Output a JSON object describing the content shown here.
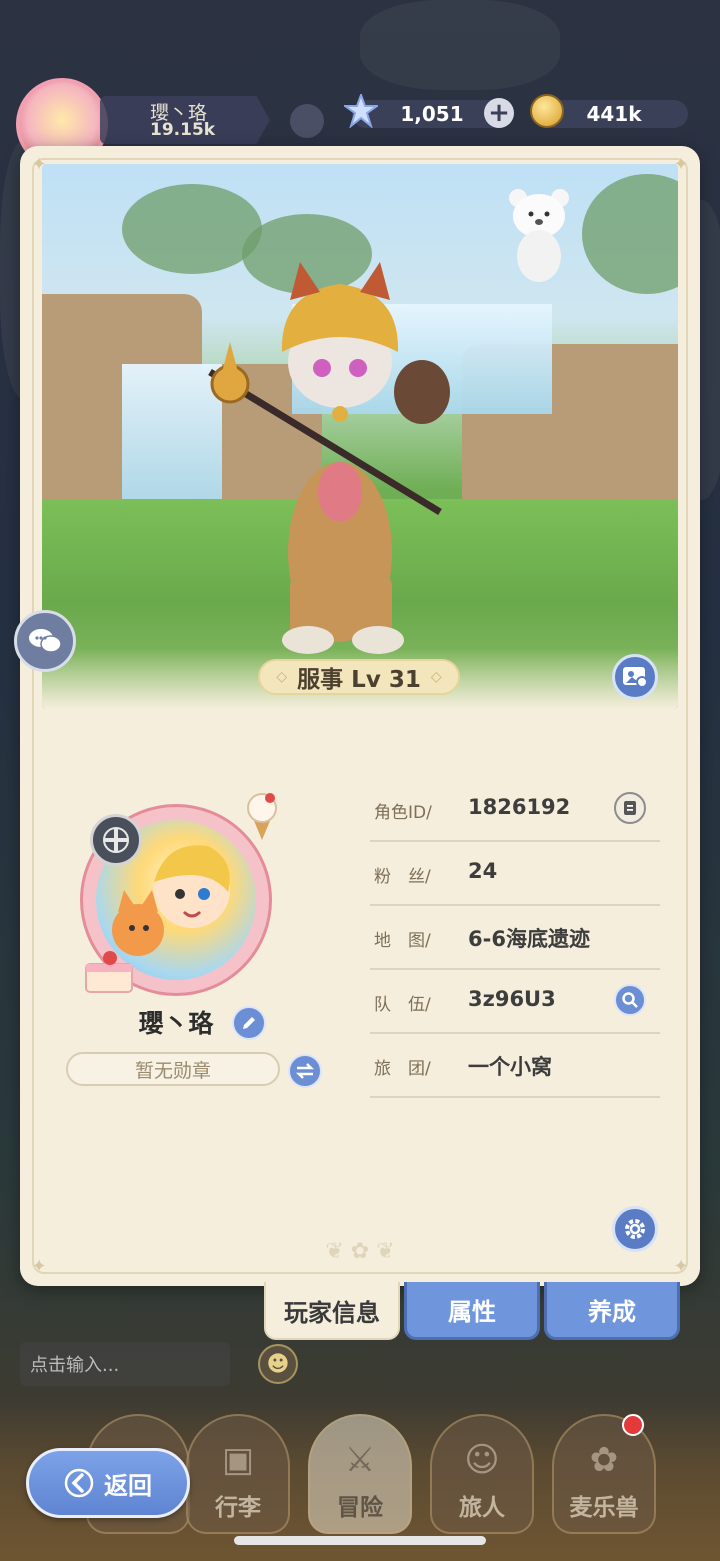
{
  "hud": {
    "player_name": "瓔丶珞",
    "power": "19.15k",
    "gems": "1,051",
    "gold": "441k",
    "plus_label": "+"
  },
  "scene": {
    "level_label": "服事 Lv 31"
  },
  "profile": {
    "name": "瓔丶珞",
    "medal": "暂无勋章",
    "rows": [
      {
        "label": "角色ID/",
        "value": "1826192"
      },
      {
        "label": "粉　丝/",
        "value": "24"
      },
      {
        "label": "地　图/",
        "value": "6-6海底遗迹"
      },
      {
        "label": "队　伍/",
        "value": "3z96U3"
      },
      {
        "label": "旅　团/",
        "value": "一个小窝"
      }
    ]
  },
  "tabs": {
    "player_info": "玩家信息",
    "attributes": "属性",
    "cultivate": "养成"
  },
  "chat": {
    "placeholder": "点击输入..."
  },
  "nav": {
    "items": [
      {
        "label": ""
      },
      {
        "label": "行李"
      },
      {
        "label": "冒险"
      },
      {
        "label": "旅人"
      },
      {
        "label": "麦乐兽"
      }
    ],
    "back_label": "返回"
  },
  "colors": {
    "accent_blue": "#6f95dc",
    "card_bg": "#f5eedd",
    "badge_red": "#e53a3a"
  },
  "icons": [
    "gem-icon",
    "coin-icon",
    "plus-icon",
    "photo-icon",
    "edit-icon",
    "swap-icon",
    "copy-icon",
    "search-icon",
    "gear-icon",
    "chat-icon",
    "emoji-icon",
    "back-arrow-icon"
  ]
}
